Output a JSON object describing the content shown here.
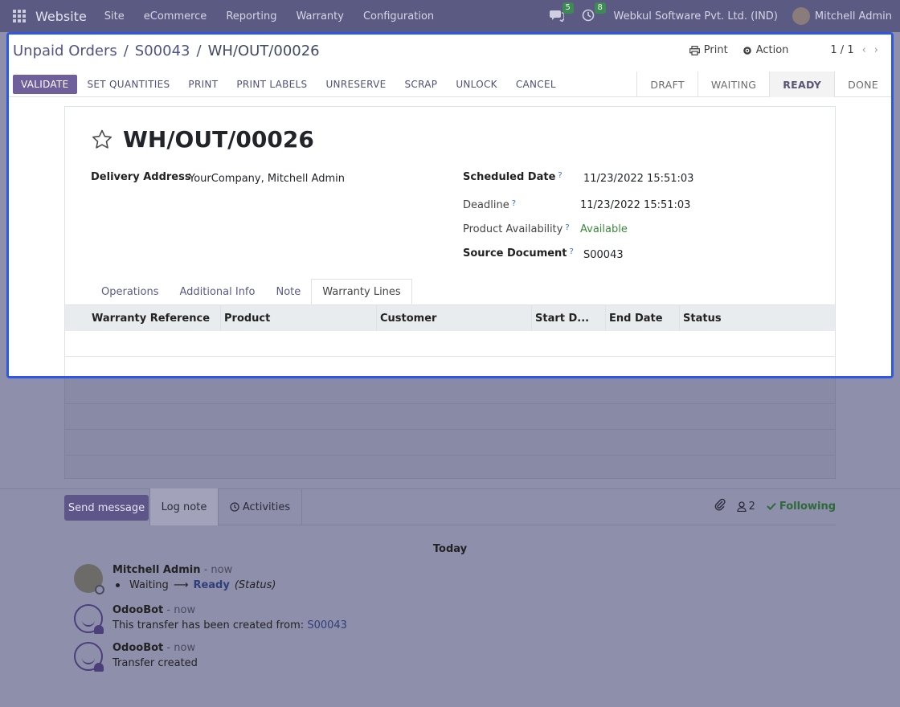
{
  "navbar": {
    "brand": "Website",
    "menu": [
      "Site",
      "eCommerce",
      "Reporting",
      "Warranty",
      "Configuration"
    ],
    "messages_count": "5",
    "activities_count": "8",
    "company": "Webkul Software Pvt. Ltd. (IND)",
    "user": "Mitchell Admin"
  },
  "breadcrumb": {
    "items": [
      "Unpaid Orders",
      "S00043"
    ],
    "current": "WH/OUT/00026"
  },
  "topright": {
    "print_label": "Print",
    "action_label": "Action",
    "pager": "1 / 1"
  },
  "actions": {
    "validate": "VALIDATE",
    "buttons": [
      "SET QUANTITIES",
      "PRINT",
      "PRINT LABELS",
      "UNRESERVE",
      "SCRAP",
      "UNLOCK",
      "CANCEL"
    ]
  },
  "stages": [
    "DRAFT",
    "WAITING",
    "READY",
    "DONE"
  ],
  "record": {
    "title": "WH/OUT/00026",
    "delivery_address_label": "Delivery Address",
    "delivery_address": "YourCompany, Mitchell Admin",
    "scheduled_date_label": "Scheduled Date",
    "scheduled_date": "11/23/2022 15:51:03",
    "deadline_label": "Deadline",
    "deadline": "11/23/2022 15:51:03",
    "availability_label": "Product Availability",
    "availability": "Available",
    "source_document_label": "Source Document",
    "source_document": "S00043"
  },
  "tabs": [
    "Operations",
    "Additional Info",
    "Note",
    "Warranty Lines"
  ],
  "table": {
    "columns": [
      "Warranty Reference",
      "Product",
      "Customer",
      "Start D...",
      "End Date",
      "Status"
    ]
  },
  "chatter": {
    "send_message": "Send message",
    "log_note": "Log note",
    "activities": "Activities",
    "followers_count": "2",
    "following": "Following",
    "today": "Today",
    "messages": [
      {
        "author": "Mitchell Admin",
        "when": "- now",
        "from": "Waiting",
        "arrow": "⟶",
        "to": "Ready",
        "field": "(Status)"
      },
      {
        "author": "OdooBot",
        "when": "- now",
        "text": "This transfer has been created from:",
        "link": "S00043"
      },
      {
        "author": "OdooBot",
        "when": "- now",
        "text": "Transfer created"
      }
    ]
  },
  "colors": {
    "navbar": "#5b5a82",
    "primary": "#6f5f9b",
    "highlight_border": "#2f57e6",
    "available": "#3a8a3a"
  }
}
